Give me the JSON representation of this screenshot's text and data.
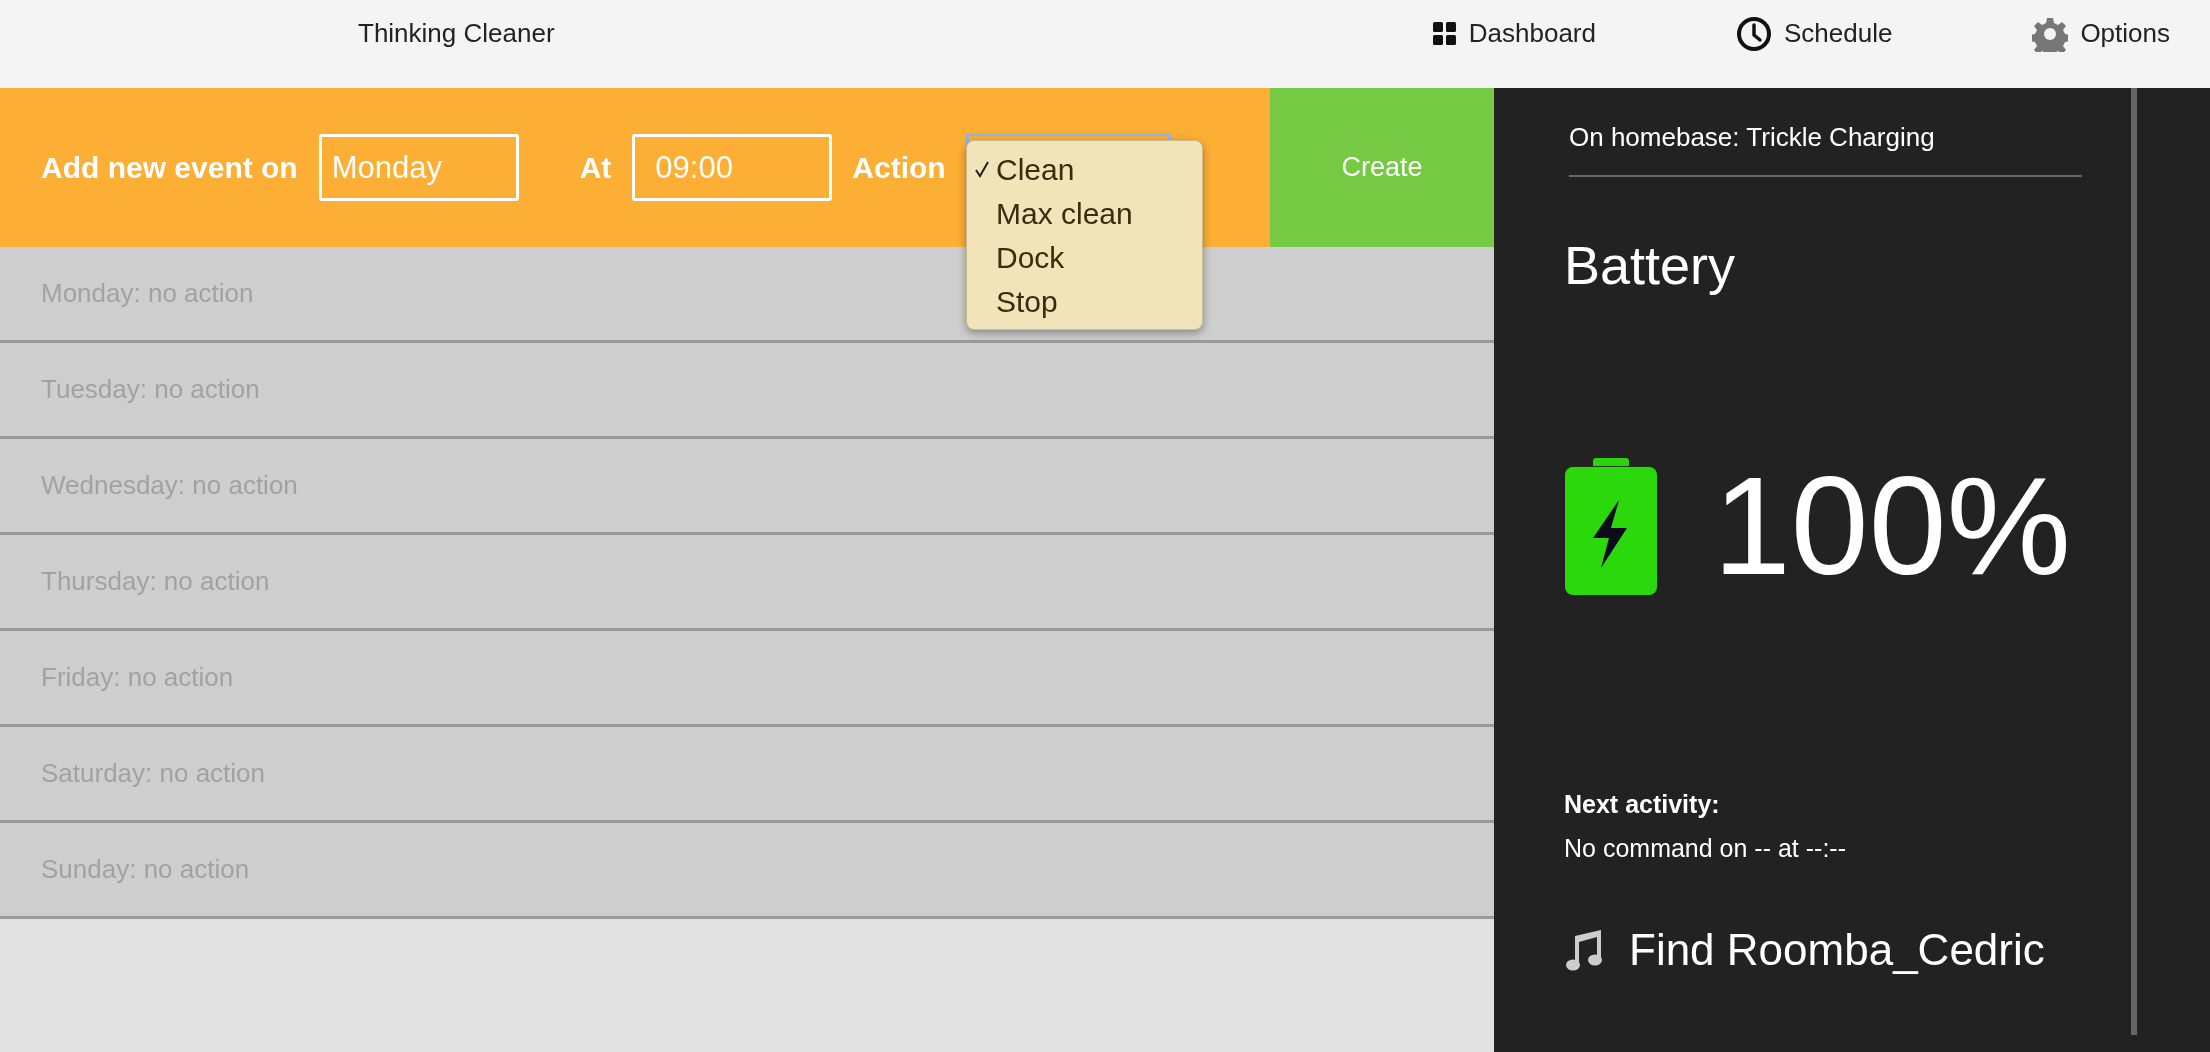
{
  "header": {
    "title": "Thinking Cleaner",
    "nav": [
      {
        "label": "Dashboard"
      },
      {
        "label": "Schedule"
      },
      {
        "label": "Options"
      }
    ]
  },
  "event_form": {
    "label_on": "Add new event on",
    "day_value": "Monday",
    "label_at": "At",
    "time_value": "09:00",
    "label_action": "Action",
    "action_menu": [
      {
        "label": "Clean",
        "selected": true
      },
      {
        "label": "Max clean",
        "selected": false
      },
      {
        "label": "Dock",
        "selected": false
      },
      {
        "label": "Stop",
        "selected": false
      }
    ],
    "create_button": "Create"
  },
  "schedule": [
    "Monday: no action",
    "Tuesday: no action",
    "Wednesday: no action",
    "Thursday: no action",
    "Friday: no action",
    "Saturday: no action",
    "Sunday: no action"
  ],
  "status_panel": {
    "status": "On homebase: Trickle Charging",
    "battery_title": "Battery",
    "level": 1,
    "battery_reading": "100%",
    "charging": true,
    "next_activity_label": "Next activity:",
    "next_activity": "No command on -- at --:--",
    "find_button": "Find Roomba_Cedric"
  }
}
